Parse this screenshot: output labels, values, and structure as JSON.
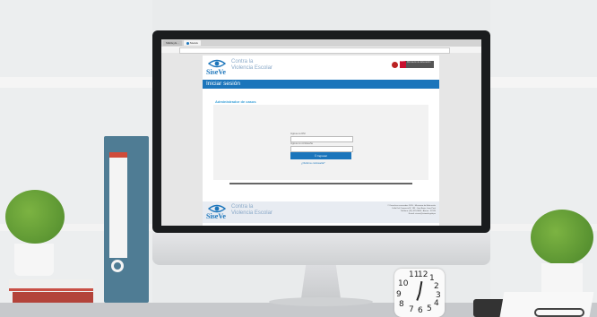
{
  "browser": {
    "tabs": [
      {
        "label": "SIEVeyG..."
      },
      {
        "label": "SiseVe"
      }
    ]
  },
  "site": {
    "logo_word": "SiseVe",
    "logo_tagline_line1": "Contra la",
    "logo_tagline_line2": "Violencia Escolar",
    "gov_red": "PERÚ",
    "gov_grey": "Ministerio de Educación"
  },
  "login": {
    "page_title": "Iniciar sesión",
    "section_title": "Administrador de casos",
    "user_label": "Ingrese su DNI",
    "password_label": "Ingrese su contraseña",
    "submit_label": "Ingresar",
    "forgot_label": "¿Olvidó su contraseña?"
  },
  "footer": {
    "logo_word": "SiseVe",
    "tagline_line1": "Contra la",
    "tagline_line2": "Violencia Escolar",
    "copyright": "© Derechos reservados 2015 · Ministerio de Educación",
    "address": "Calle Del Comercio N° 193 - San Borja, Lima Perú",
    "phone": "Teléfono: (01) 615-5800 - Anexo : 22745",
    "email": "E-mail: siseve@minedu.gob.pe"
  },
  "clock": {
    "numbers": [
      "11",
      "12",
      "1",
      "10",
      "2",
      "9",
      "3",
      "8",
      "7",
      "6",
      "5",
      "4"
    ]
  },
  "colors": {
    "brand_blue": "#1b75bb",
    "accent_cyan": "#3aa0d8",
    "gov_red": "#c8102e"
  },
  "icons": {
    "logo": "eye-icon",
    "gov_shield": "shield-icon",
    "submit": "key-icon"
  }
}
